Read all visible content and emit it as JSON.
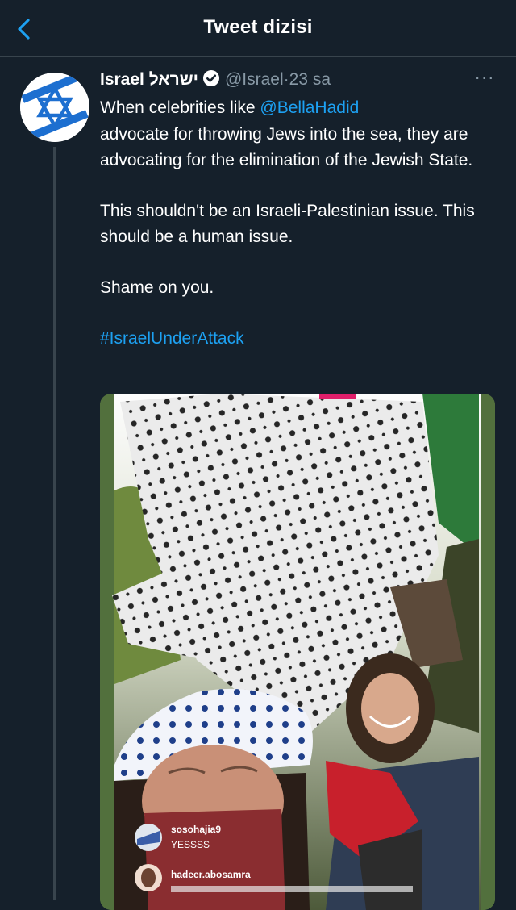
{
  "header": {
    "title": "Tweet dizisi"
  },
  "tweet": {
    "display_name": "Israel ישראל",
    "handle": "@Israel",
    "separator": "·",
    "time": "23 sa",
    "more": "···",
    "body": {
      "line1_prefix": "When celebrities like ",
      "mention": "@BellaHadid",
      "line1_rest": "advocate for throwing Jews into the sea, they are advocating for the elimination of the Jewish State.",
      "paragraph2": "This shouldn't be an Israeli-Palestinian issue. This should be a human issue.",
      "paragraph3": "Shame on you.",
      "hashtag": "#IsraelUnderAttack"
    }
  },
  "media": {
    "comments": [
      {
        "user": "sosohajia9",
        "text": "YESSSS"
      },
      {
        "user": "hadeer.abosamra",
        "text": ""
      }
    ]
  },
  "colors": {
    "background": "#15202b",
    "accent": "#1da1f2",
    "secondary_text": "#8899a6",
    "divider": "#38444d"
  },
  "icons": {
    "back": "chevron-left-icon",
    "verified": "verified-badge-icon",
    "avatar": "star-of-david-icon",
    "more": "more-horizontal-icon"
  }
}
